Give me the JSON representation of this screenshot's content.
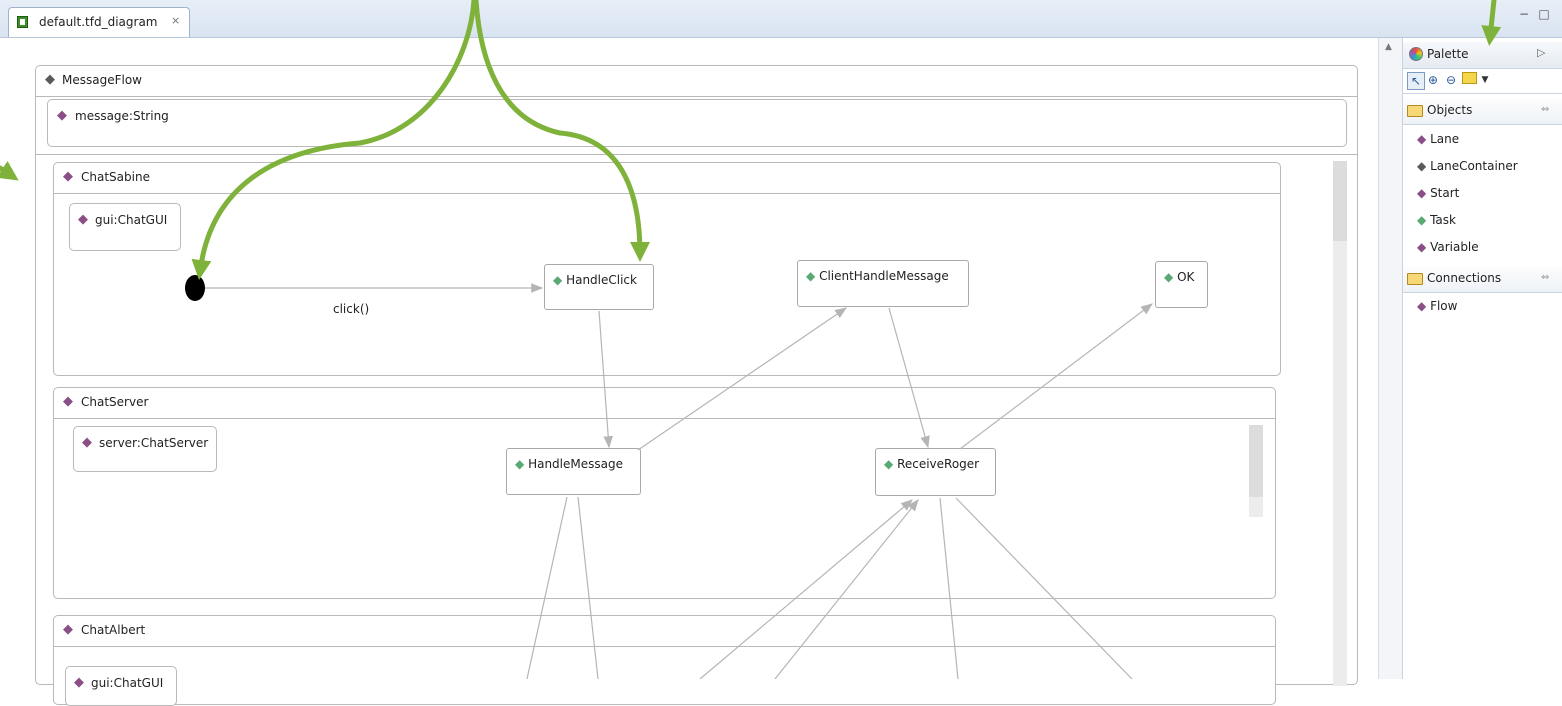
{
  "tab": {
    "title": "default.tfd_diagram",
    "close_glyph": "⨯"
  },
  "window_controls": {
    "minimize": "−",
    "maximize": "□"
  },
  "diagram": {
    "root": {
      "name": "MessageFlow",
      "variable": "message:String"
    },
    "lanes": [
      {
        "name": "ChatSabine",
        "variable": "gui:ChatGUI",
        "tasks": [
          "HandleClick",
          "ClientHandleMessage",
          "OK"
        ],
        "flow_label": "click()"
      },
      {
        "name": "ChatServer",
        "variable": "server:ChatServer",
        "tasks": [
          "HandleMessage",
          "ReceiveRoger"
        ]
      },
      {
        "name": "ChatAlbert",
        "variable": "gui:ChatGUI"
      }
    ]
  },
  "palette": {
    "title": "Palette",
    "groups": [
      {
        "label": "Objects",
        "items": [
          "Lane",
          "LaneContainer",
          "Start",
          "Task",
          "Variable"
        ]
      },
      {
        "label": "Connections",
        "items": [
          "Flow"
        ]
      }
    ]
  },
  "colors": {
    "annotation_arrow": "#7fb23a",
    "flow_line": "#b5b5b5",
    "diamond_purple": "#8a4f86",
    "diamond_green": "#5aa872",
    "diamond_gray": "#5a5a5a"
  },
  "icons": {
    "file": "diagram-file-icon",
    "palette": "palette-icon",
    "select": "select-arrow-icon",
    "zoom_in": "zoom-in-icon",
    "zoom_out": "zoom-out-icon",
    "note": "note-icon"
  }
}
